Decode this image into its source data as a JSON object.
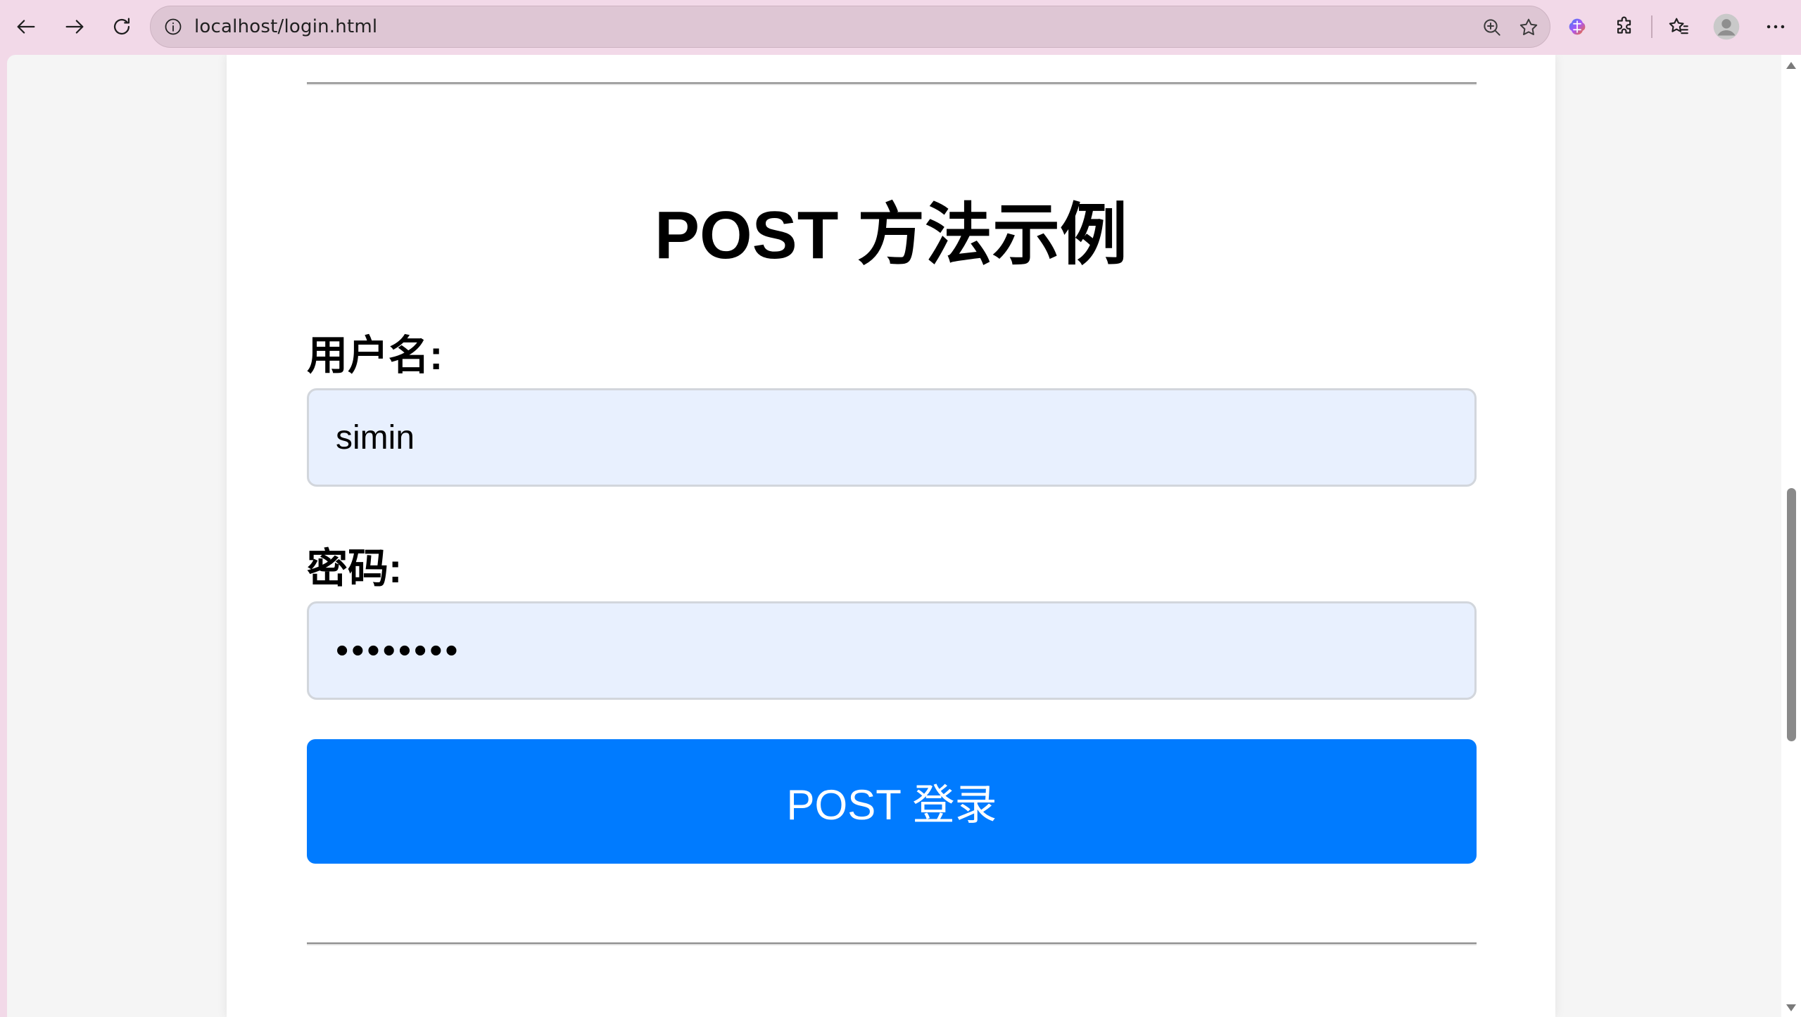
{
  "browser": {
    "url": "localhost/login.html",
    "icons": {
      "back": "arrow-left-icon",
      "forward": "arrow-right-icon",
      "reload": "reload-icon",
      "site_info": "info-icon",
      "zoom": "zoom-in-icon",
      "favorite": "star-icon",
      "copilot": "copilot-icon",
      "extensions": "puzzle-icon",
      "favorites": "favorites-icon",
      "profile": "profile-icon",
      "menu": "more-icon"
    }
  },
  "page": {
    "heading": "POST 方法示例",
    "username_label": "用户名:",
    "username_value": "simin",
    "password_label": "密码:",
    "password_value": "simin123",
    "submit_label": "POST 登录"
  },
  "colors": {
    "button": "#007bff",
    "input_background": "#e8f0fe",
    "browser_frame": "#f2d9e8"
  }
}
